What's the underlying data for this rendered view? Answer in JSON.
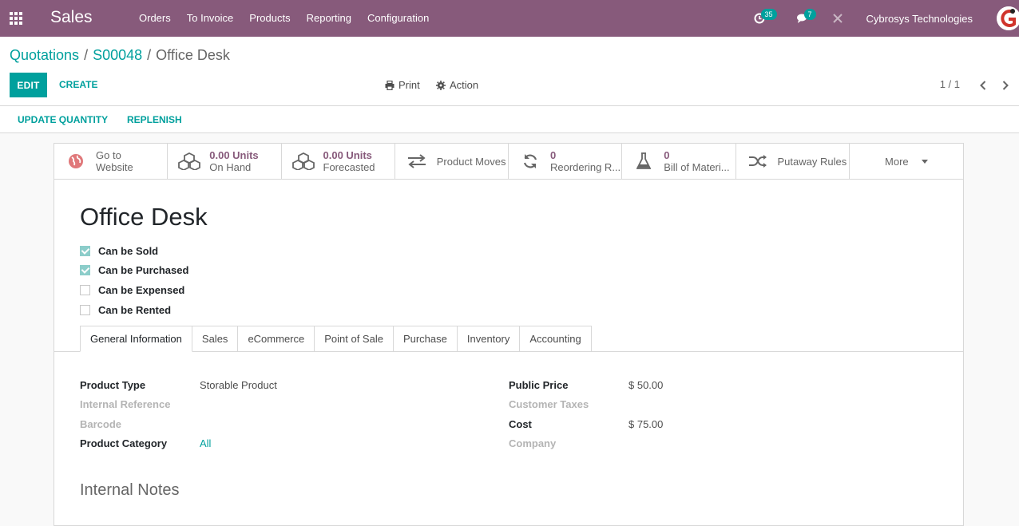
{
  "navbar": {
    "brand": "Sales",
    "menu": [
      "Orders",
      "To Invoice",
      "Products",
      "Reporting",
      "Configuration"
    ],
    "activity_count": "35",
    "message_count": "7",
    "company": "Cybrosys Technologies",
    "accent": "#875a7b"
  },
  "breadcrumb": {
    "first": "Quotations",
    "second": "S00048",
    "current": "Office Desk",
    "separator": "/"
  },
  "control_panel": {
    "edit_label": "EDIT",
    "create_label": "CREATE",
    "print_label": "Print",
    "action_label": "Action",
    "pager": "1 / 1"
  },
  "statusbar": {
    "update_quantity": "UPDATE QUANTITY",
    "replenish": "REPLENISH"
  },
  "smart_buttons": [
    {
      "value": "",
      "label": "Go to",
      "label2": "Website",
      "icon": "globe-icon"
    },
    {
      "value": "0.00 Units",
      "label": "On Hand",
      "icon": "cubes-icon"
    },
    {
      "value": "0.00 Units",
      "label": "Forecasted",
      "icon": "cubes-icon"
    },
    {
      "value": "",
      "label": "Product Moves",
      "icon": "exchange-icon"
    },
    {
      "value": "0",
      "label": "Reordering R...",
      "icon": "refresh-icon"
    },
    {
      "value": "0",
      "label": "Bill of Materi...",
      "icon": "flask-icon"
    },
    {
      "value": "",
      "label": "Putaway Rules",
      "icon": "random-icon"
    },
    {
      "value": "",
      "label": "More",
      "icon": "caret-down-icon"
    }
  ],
  "product": {
    "name": "Office Desk",
    "checkboxes": [
      {
        "label": "Can be Sold",
        "checked": true
      },
      {
        "label": "Can be Purchased",
        "checked": true
      },
      {
        "label": "Can be Expensed",
        "checked": false
      },
      {
        "label": "Can be Rented",
        "checked": false
      }
    ]
  },
  "tabs": [
    "General Information",
    "Sales",
    "eCommerce",
    "Point of Sale",
    "Purchase",
    "Inventory",
    "Accounting"
  ],
  "fields_left": [
    {
      "label": "Product Type",
      "value": "Storable Product"
    },
    {
      "label": "Internal Reference",
      "value": ""
    },
    {
      "label": "Barcode",
      "value": ""
    },
    {
      "label": "Product Category",
      "value": "All"
    }
  ],
  "fields_right": [
    {
      "label": "Public Price",
      "value": "$ 50.00"
    },
    {
      "label": "Customer Taxes",
      "value": ""
    },
    {
      "label": "Cost",
      "value": "$ 75.00"
    },
    {
      "label": "Company",
      "value": ""
    }
  ],
  "notes": {
    "title": "Internal Notes"
  }
}
